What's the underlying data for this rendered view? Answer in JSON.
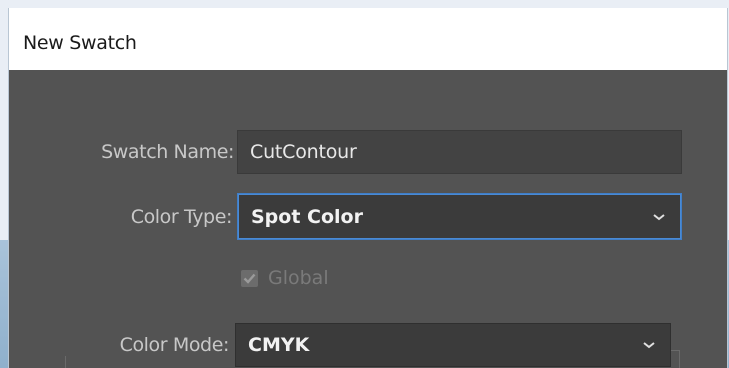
{
  "dialog": {
    "title": "New Swatch"
  },
  "form": {
    "swatch_name": {
      "label": "Swatch Name:",
      "value": "CutContour"
    },
    "color_type": {
      "label": "Color Type:",
      "value": "Spot Color"
    },
    "global": {
      "label": "Global",
      "checked": true,
      "enabled": false
    },
    "color_mode": {
      "label": "Color Mode:",
      "value": "CMYK"
    }
  },
  "colors": {
    "panel_bg": "#535353",
    "field_bg": "#434343",
    "focus_ring": "#4a8ad4",
    "label_text": "#c8c8c8"
  },
  "icons": {
    "dropdown": "chevron-down-icon",
    "checkbox": "checkmark-icon"
  }
}
